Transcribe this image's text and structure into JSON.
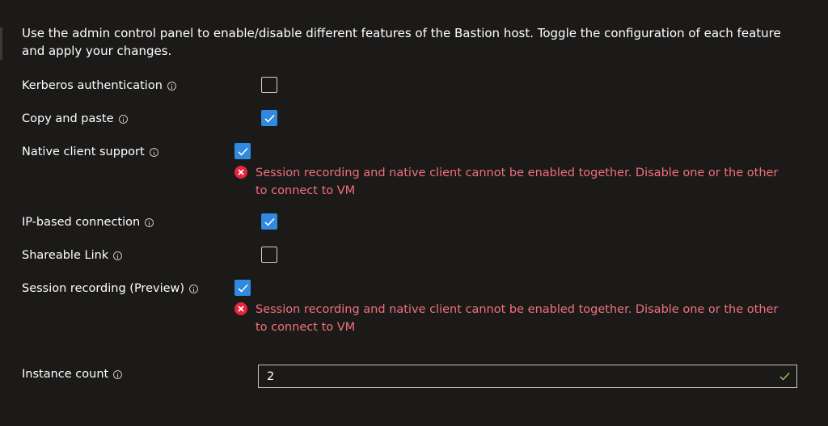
{
  "intro": {
    "text": "Use the admin control panel to enable/disable different features of the Bastion host. Toggle the configuration of each feature and apply your changes."
  },
  "features": [
    {
      "label": "Kerberos authentication",
      "checked": false
    },
    {
      "label": "Copy and paste",
      "checked": true
    },
    {
      "label": "Native client support",
      "checked": true,
      "error": "Session recording and native client cannot be enabled together. Disable one or the other to connect to VM"
    },
    {
      "label": "IP-based connection",
      "checked": true
    },
    {
      "label": "Shareable Link",
      "checked": false
    },
    {
      "label": "Session recording (Preview)",
      "checked": true,
      "error": "Session recording and native client cannot be enabled together. Disable one or the other to connect to VM"
    }
  ],
  "instance": {
    "label": "Instance count",
    "value": "2"
  },
  "colors": {
    "background": "#1b1a19",
    "checkbox_checked": "#2f8ae0",
    "error_text": "#f1707b",
    "error_icon": "#e8243b",
    "valid_check": "#92c353"
  },
  "icons": {
    "info": "info-icon",
    "error": "error-circle-icon",
    "check": "checkmark-icon",
    "valid": "valid-checkmark-icon"
  }
}
